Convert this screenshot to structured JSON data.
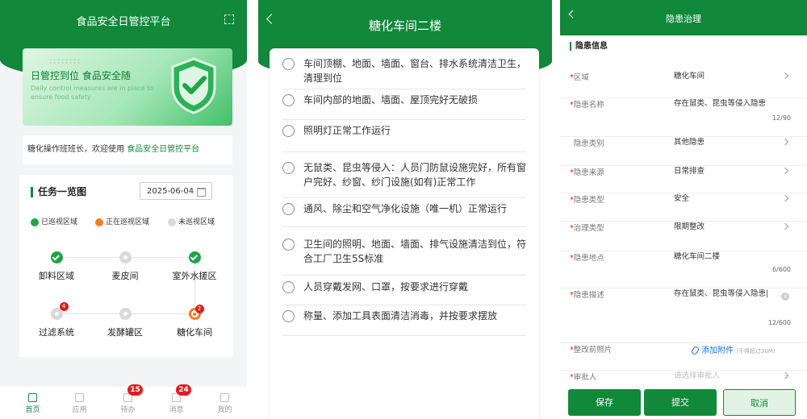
{
  "panel1": {
    "title": "食品安全日管控平台",
    "banner": {
      "headline": "日管控到位 食品安全随",
      "subline": "Daily control measures are in place to ensure food safety"
    },
    "welcome": {
      "prefix": "糖化操作班班长，欢迎使用 ",
      "platform": "食品安全日管控平台"
    },
    "tasks": {
      "title": "任务一览图",
      "date": "2025-06-04",
      "legend": {
        "done": "已巡视区域",
        "doing": "正在巡视区域",
        "todo": "未巡视区域"
      },
      "nodes": [
        {
          "label": "卸料区域",
          "status": "done",
          "badge": ""
        },
        {
          "label": "麦皮间",
          "status": "todo",
          "badge": ""
        },
        {
          "label": "室外水搓区",
          "status": "done",
          "badge": ""
        },
        {
          "label": "过滤系统",
          "status": "todo",
          "badge": "4"
        },
        {
          "label": "发酵罐区",
          "status": "todo",
          "badge": ""
        },
        {
          "label": "糖化车间",
          "status": "doing",
          "badge": "2"
        }
      ]
    },
    "tabbar": [
      {
        "label": "首页",
        "badge": "",
        "active": true
      },
      {
        "label": "应用",
        "badge": "",
        "active": false
      },
      {
        "label": "待办",
        "badge": "15",
        "active": false
      },
      {
        "label": "消息",
        "badge": "24",
        "active": false
      },
      {
        "label": "我的",
        "badge": "",
        "active": false
      }
    ],
    "colors": {
      "brand": "#11883a",
      "done": "#22a347",
      "doing": "#f47c20",
      "badge": "#e41c1c"
    }
  },
  "panel2": {
    "title": "糖化车间二楼",
    "items": [
      "车间顶棚、地面、墙面、窗台、排水系统清洁卫生，清理到位",
      "车间内部的地面、墙面、屋顶完好无破损",
      "照明灯正常工作运行",
      "无鼠类、昆虫等侵入：人员门防鼠设施完好，所有窗户完好、纱窗、纱门设施(如有)正常工作",
      "通风、除尘和空气净化设施（唯一机）正常运行",
      "卫生间的照明、地面、墙面、排气设施清洁到位，符合工厂卫生5S标准",
      "人员穿戴发网、口罩，按要求进行穿戴",
      "称量、添加工具表面清洁消毒，并按要求摆放"
    ]
  },
  "panel3": {
    "title": "隐患治理",
    "section": "隐患信息",
    "fields": [
      {
        "label": "区域",
        "required": true,
        "value": "糖化车间",
        "arrow": true,
        "counter": ""
      },
      {
        "label": "隐患名称",
        "required": true,
        "value": "存在鼠类、昆虫等侵入隐患",
        "arrow": false,
        "counter": "12/90"
      },
      {
        "label": "隐患类别",
        "required": false,
        "value": "其他隐患",
        "arrow": true,
        "counter": ""
      },
      {
        "label": "隐患来源",
        "required": true,
        "value": "日常排查",
        "arrow": true,
        "counter": ""
      },
      {
        "label": "隐患类型",
        "required": true,
        "value": "安全",
        "arrow": true,
        "counter": ""
      },
      {
        "label": "治理类型",
        "required": true,
        "value": "限期整改",
        "arrow": true,
        "counter": ""
      },
      {
        "label": "隐患地点",
        "required": true,
        "value": "糖化车间二楼",
        "arrow": false,
        "counter": "6/600"
      },
      {
        "label": "隐患描述",
        "required": true,
        "value": "存在鼠类、昆虫等侵入隐患|",
        "arrow": false,
        "counter": "12/600"
      },
      {
        "label": "整改前照片",
        "required": true,
        "value": "",
        "arrow": false,
        "counter": ""
      },
      {
        "label": "审批人",
        "required": true,
        "value": "请选择审批人",
        "placeholder": true,
        "arrow": true,
        "counter": ""
      }
    ],
    "clear_glyph": "×",
    "attachment": {
      "label": "添加附件",
      "hint": "(不得超过30M)"
    },
    "buttons": {
      "save": "保存",
      "submit": "提交",
      "cancel": "取消"
    }
  }
}
